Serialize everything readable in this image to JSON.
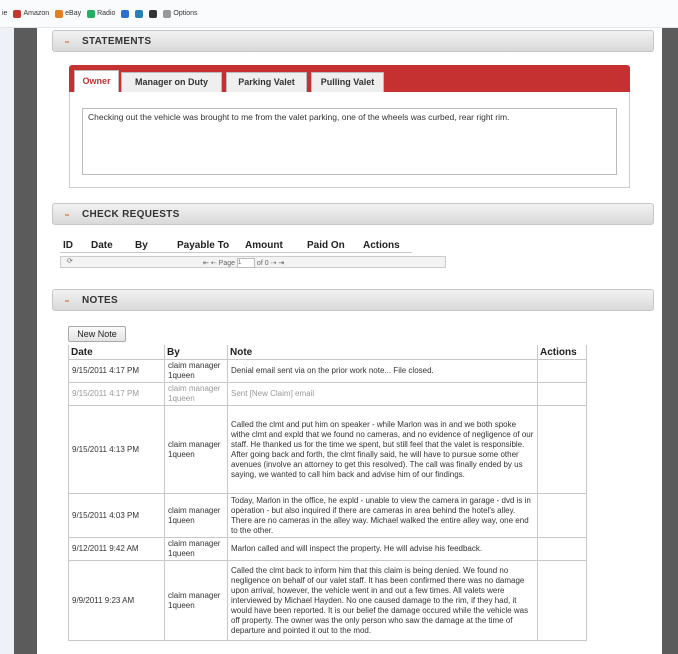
{
  "browser_bar": {
    "items": [
      {
        "label": "ie",
        "color": ""
      },
      {
        "label": "Amazon",
        "color": "#c0392b"
      },
      {
        "label": "eBay",
        "color": "#e67e22"
      },
      {
        "label": "Radio",
        "color": "#27ae60"
      },
      {
        "label": "",
        "color": "#2c6fd1"
      },
      {
        "label": "",
        "color": "#2980b9"
      },
      {
        "label": "",
        "color": "#333333"
      },
      {
        "label": "Options",
        "color": "#999999"
      }
    ]
  },
  "statements": {
    "title": "STATEMENTS",
    "tabs": [
      "Owner",
      "Manager on Duty",
      "Parking Valet",
      "Pulling Valet"
    ],
    "active_tab": "Owner",
    "text": "Checking out the vehicle was brought  to me from the valet parking, one of the wheels was curbed, rear right rim."
  },
  "check_requests": {
    "title": "CHECK REQUESTS",
    "columns": [
      "ID",
      "Date",
      "By",
      "Payable To",
      "Amount",
      "Paid On",
      "Actions"
    ],
    "pager": {
      "page_label": "Page",
      "page_value": "1",
      "of_label": "of 0"
    }
  },
  "notes": {
    "title": "NOTES",
    "new_note_label": "New Note",
    "columns": [
      "Date",
      "By",
      "Note",
      "Actions"
    ],
    "rows": [
      {
        "date": "9/15/2011 4:17 PM",
        "by": "claim manager 1queen",
        "note": "Denial email sent via on the prior work note... File closed."
      },
      {
        "date": "9/15/2011 4:17 PM",
        "by": "claim manager 1queen",
        "note": "Sent [New Claim] email"
      },
      {
        "date": "9/15/2011 4:13 PM",
        "by": "claim manager 1queen",
        "note": "Called the clmt and put him on speaker - while Marlon was in and we both spoke withe clmt and expld that we found no cameras, and no evidence of negligence of our staff. He thanked us for the time we spent, but still feel that the valet is responsible. After going back and forth, the clmt finally said, he will have to pursue some other avenues (involve an attorney to get this resolved). The call was finally ended by us saying, we wanted to call him back and advise him of our findings."
      },
      {
        "date": "9/15/2011 4:03 PM",
        "by": "claim manager 1queen",
        "note": "Today, Marlon in the office, he expld - unable to view the camera in garage - dvd is in operation - but also inquired if there are cameras in area behind the hotel's alley. There are no cameras in the alley way. Michael walked the entire alley way, one end to the other."
      },
      {
        "date": "9/12/2011 9:42 AM",
        "by": "claim manager 1queen",
        "note": "Marlon called and will inspect the property. He will advise his feedback."
      },
      {
        "date": "9/9/2011 9:23 AM",
        "by": "claim manager 1queen",
        "note": "Called the clmt back to inform him that this claim is being denied. We found no negligence on behalf of our valet staff. It has been confirmed there was no damage upon arrival, however, the vehicle went in and out a few times. All valets were interviewed by Michael Hayden. No one caused damage to the rim, if they had, it would have been reported. It is our belief the damage occured while the vehicle was off property. The owner was the only person who saw the damage at the time of departure and pointed it out to the mod."
      }
    ]
  }
}
